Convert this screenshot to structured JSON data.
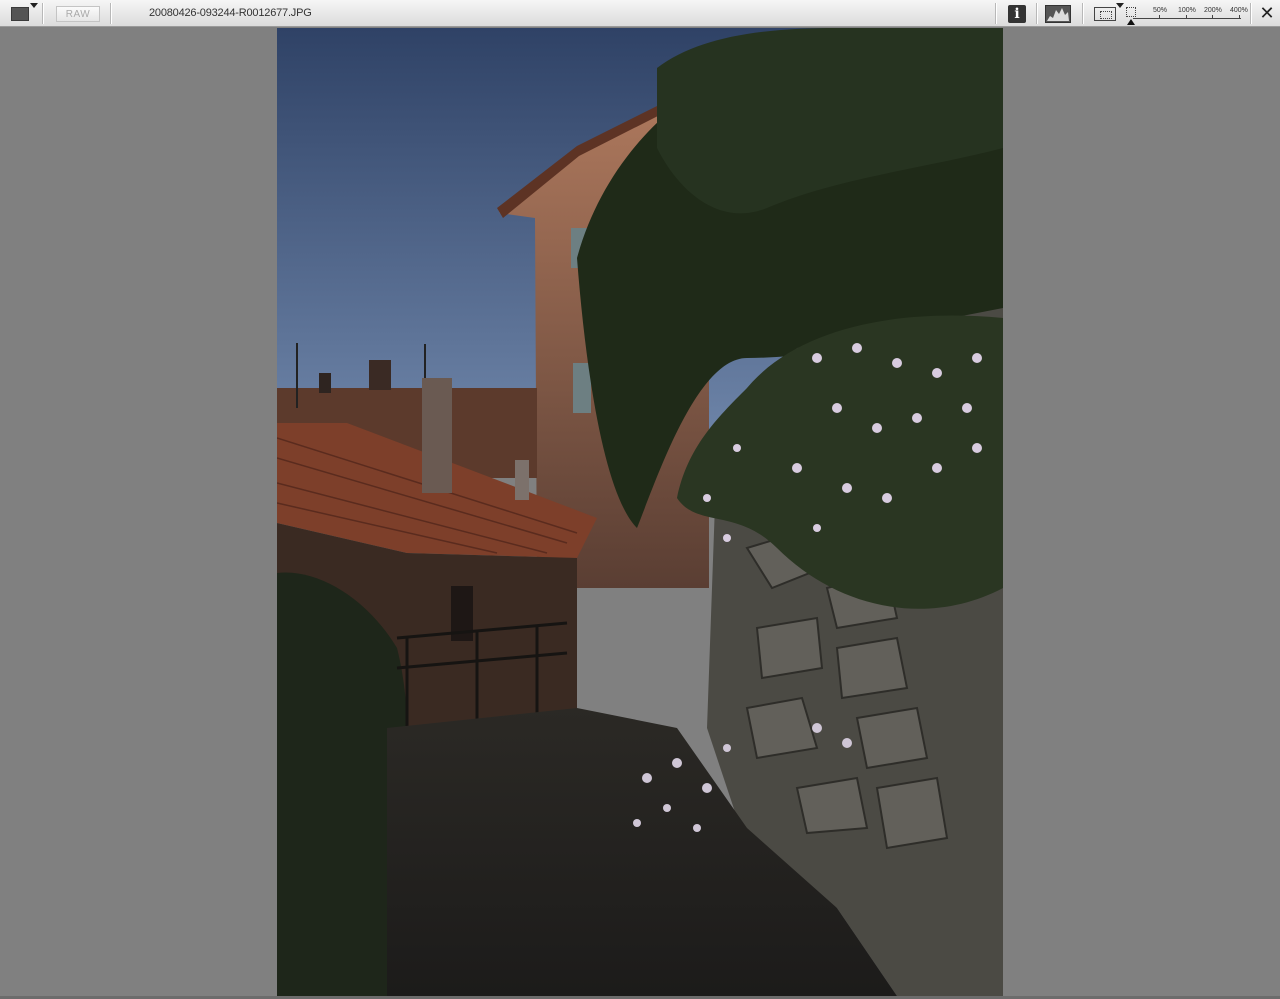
{
  "window": {
    "file_name": "20080426-093244-R0012677.JPG"
  },
  "toolbar": {
    "view_mode_icon": "single-view-icon",
    "raw_label": "RAW",
    "info_icon": "info-icon",
    "info_glyph": "i",
    "histogram_icon": "histogram-icon",
    "fit_icon": "fit-to-window-icon",
    "zoom_levels": [
      "50%",
      "100%",
      "200%",
      "400%"
    ],
    "close_glyph": "✕"
  },
  "colors": {
    "background": "#808080",
    "toolbar": "#e6e6e6"
  }
}
